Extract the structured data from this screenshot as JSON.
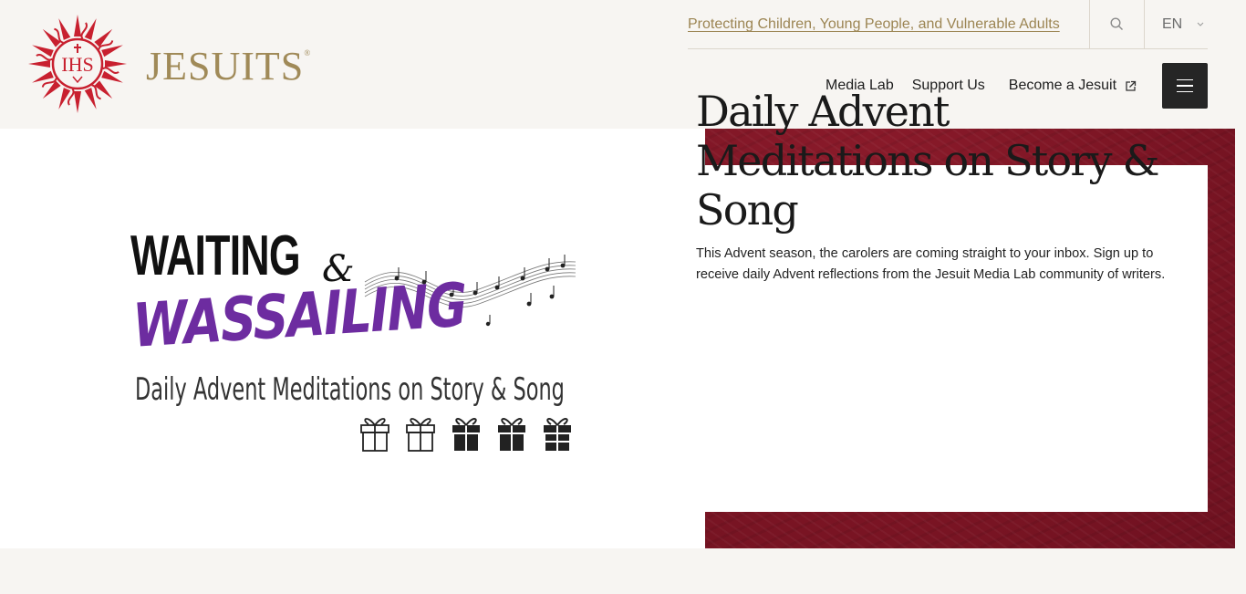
{
  "header": {
    "logo": {
      "seal_text": "IHS",
      "wordmark": "JESUITS",
      "trademark": "®"
    },
    "utility": {
      "safeguarding_link": "Protecting Children, Young People, and Vulnerable Adults",
      "search_icon": "search-icon",
      "language": "EN",
      "language_icon": "chevron-down-icon"
    },
    "nav": {
      "items": [
        "Media Lab",
        "Support Us",
        "Become a Jesuit"
      ],
      "external_icon": "external-link-icon",
      "menu_icon": "hamburger-menu-icon"
    }
  },
  "hero": {
    "title": "Daily Advent Meditations on Story & Song",
    "description": "This Advent season, the carolers are coming straight to your inbox. Sign up to receive daily Advent reflections from the Jesuit Media Lab community of writers.",
    "promo": {
      "line1": "WAITING",
      "ampersand": "&",
      "line2": "WASSAILING",
      "subtitle": "Daily Advent Meditations on Story & Song"
    }
  },
  "colors": {
    "background": "#f7f5f2",
    "accent_gold": "#9c8553",
    "crimson": "#7c1524",
    "seal_red": "#c8202f",
    "promo_purple": "#6d2ca0",
    "menu_button": "#252525"
  }
}
